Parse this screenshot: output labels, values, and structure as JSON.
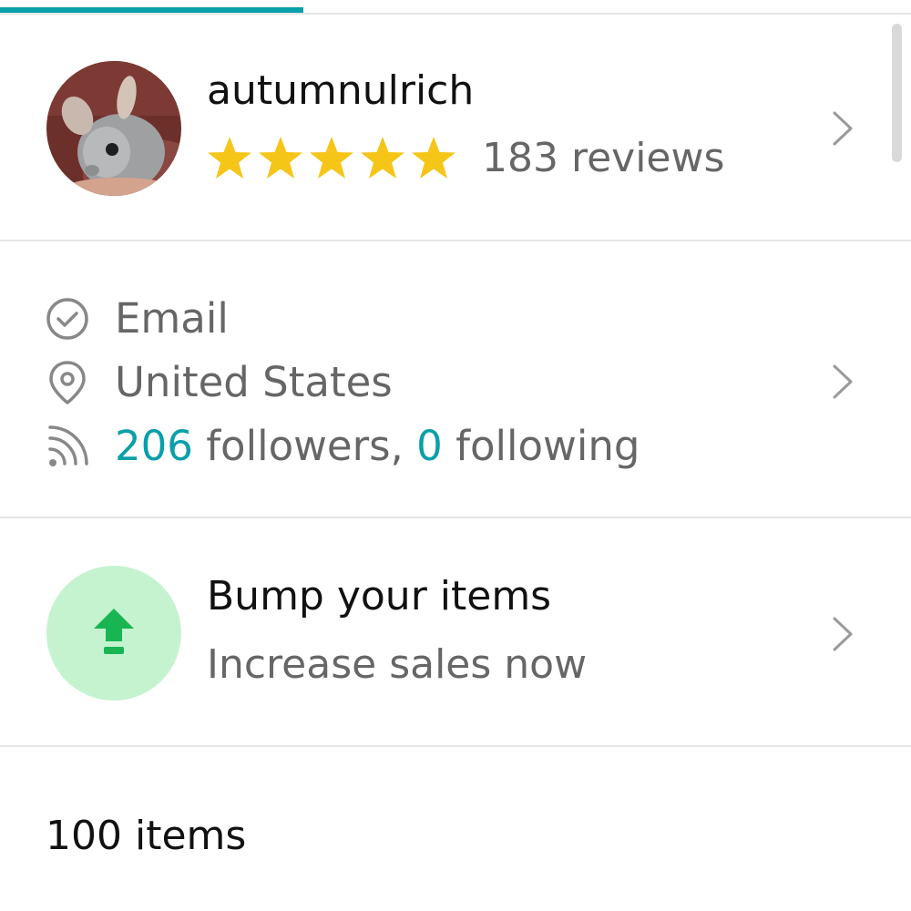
{
  "progress_fraction": 0.333,
  "colors": {
    "accent": "#0a9faa",
    "star": "#f5c518",
    "bump_bg": "#c6f3cf",
    "bump_icon": "#19b553",
    "text_secondary": "#666666"
  },
  "profile": {
    "username": "autumnulrich",
    "rating_stars": 5,
    "reviews_label": "183 reviews"
  },
  "info": {
    "email_label": "Email",
    "location": "United States",
    "followers_count": "206",
    "followers_label": " followers, ",
    "following_count": "0",
    "following_label": " following"
  },
  "bump": {
    "title": "Bump your items",
    "subtitle": "Increase sales now"
  },
  "items_count_label": "100 items",
  "icons": {
    "verified": "check-circle-icon",
    "location": "location-pin-icon",
    "followers": "rss-feed-icon",
    "bump": "bump-arrow-icon",
    "chevron": "chevron-right-icon"
  }
}
